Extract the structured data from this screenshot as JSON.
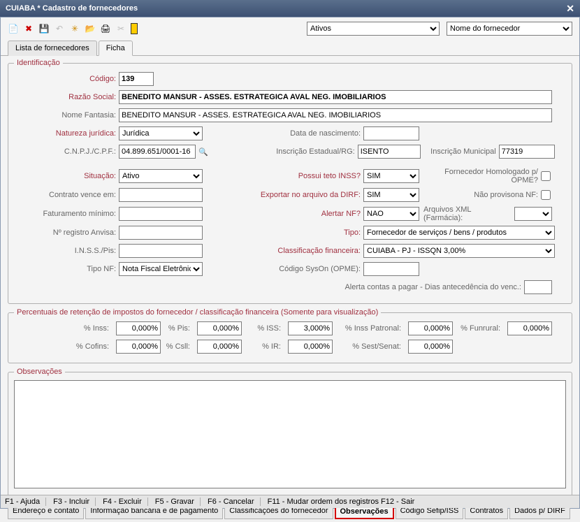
{
  "window": {
    "title": "CUIABA * Cadastro de fornecedores"
  },
  "toolbar": {
    "filter1": "Ativos",
    "filter2": "Nome do fornecedor"
  },
  "tabs": {
    "list": "Lista de fornecedores",
    "ficha": "Ficha"
  },
  "ident": {
    "legend": "Identificação",
    "codigo_lbl": "Código:",
    "codigo": "139",
    "razao_lbl": "Razão Social:",
    "razao": "BENEDITO MANSUR - ASSES. ESTRATEGICA AVAL NEG. IMOBILIARIOS",
    "fantasia_lbl": "Nome Fantasia:",
    "fantasia": "BENEDITO MANSUR - ASSES. ESTRATEGICA AVAL NEG. IMOBILIARIOS",
    "natureza_lbl": "Natureza jurídica:",
    "natureza": "Jurídica",
    "nascimento_lbl": "Data de nascimento:",
    "cnpj_lbl": "C.N.P.J./C.P.F.:",
    "cnpj": "04.899.651/0001-16",
    "insc_est_lbl": "Inscrição Estadual/RG:",
    "insc_est": "ISENTO",
    "insc_mun_lbl": "Inscrição Municipal",
    "insc_mun": "77319",
    "situacao_lbl": "Situação:",
    "situacao": "Ativo",
    "teto_inss_lbl": "Possui teto INSS?",
    "teto_inss": "SIM",
    "homolog_lbl": "Fornecedor Homologado p/ OPME?",
    "contrato_lbl": "Contrato vence em:",
    "dirf_lbl": "Exportar no arquivo da DIRF:",
    "dirf": "SIM",
    "provisiona_lbl": "Não provisona NF:",
    "faturamento_lbl": "Faturamento mínimo:",
    "alertar_nf_lbl": "Alertar NF?",
    "alertar_nf": "NAO",
    "xml_farm_lbl": "Arquivos XML (Farmácia):",
    "anvisa_lbl": "Nº registro Anvisa:",
    "tipo_lbl": "Tipo:",
    "tipo": "Fornecedor de serviços / bens / produtos",
    "inss_pis_lbl": "I.N.S.S./Pis:",
    "class_fin_lbl": "Classificação financeira:",
    "class_fin": "CUIABA - PJ - ISSQN 3,00%",
    "tipo_nf_lbl": "Tipo NF:",
    "tipo_nf": "Nota Fiscal Eletrônic",
    "syson_lbl": "Código SysOn (OPME):",
    "alerta_contas_lbl": "Alerta contas a pagar - Dias antecedência do venc.:"
  },
  "perc": {
    "legend": "Percentuais de retenção de impostos do fornecedor / classificação financeira (Somente para visualização)",
    "inss_lbl": "% Inss:",
    "inss": "0,000%",
    "pis_lbl": "% Pis:",
    "pis": "0,000%",
    "iss_lbl": "% ISS:",
    "iss": "3,000%",
    "inss_pat_lbl": "% Inss Patronal:",
    "inss_pat": "0,000%",
    "funrural_lbl": "% Funrural:",
    "funrural": "0,000%",
    "cofins_lbl": "% Cofins:",
    "cofins": "0,000%",
    "csll_lbl": "% Csll:",
    "csll": "0,000%",
    "ir_lbl": "% IR:",
    "ir": "0,000%",
    "sest_lbl": "% Sest/Senat:",
    "sest": "0,000%"
  },
  "obs": {
    "legend": "Observações"
  },
  "bottom_tabs": {
    "t1": "Endereço e contato",
    "t2": "Informação bancária e de pagamento",
    "t3": "Classificações do fornecedor",
    "t4": "Observações",
    "t5": "Código Sefip/ISS",
    "t6": "Contratos",
    "t7": "Dados p/ DIRF"
  },
  "status": {
    "f1": "F1 - Ajuda",
    "f3": "F3 - Incluir",
    "f4": "F4 - Excluir",
    "f5": "F5 - Gravar",
    "f6": "F6 - Cancelar",
    "f11": "F11 - Mudar ordem dos registros F12 - Sair"
  }
}
